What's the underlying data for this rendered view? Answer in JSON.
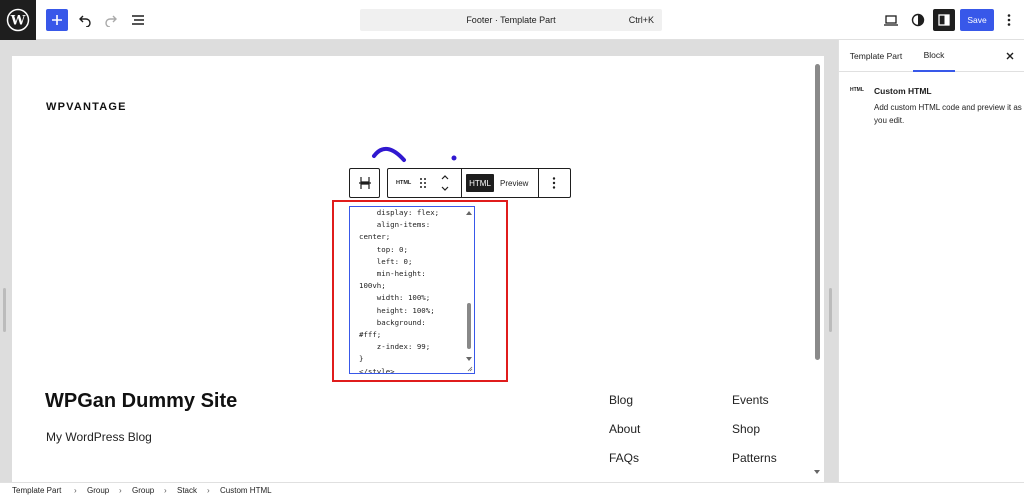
{
  "topbar": {
    "logo_icon": "wordpress-logo-icon",
    "doc_title": "Footer · Template Part",
    "doc_shortcut": "Ctrl+K",
    "save_label": "Save",
    "accent_color": "#3858e9"
  },
  "canvas": {
    "site_logo_text": "WPVANTAGE",
    "site_title": "WPGan Dummy Site",
    "site_tagline": "My WordPress Blog",
    "nav_col1": [
      "Blog",
      "About",
      "FAQs"
    ],
    "nav_col2": [
      "Events",
      "Shop",
      "Patterns"
    ]
  },
  "block_toolbar": {
    "type_label": "HTML",
    "html_tab": "HTML",
    "preview_tab": "Preview"
  },
  "code_editor": {
    "lines": "    display: flex;\n    align-items:\ncenter;\n    top: 0;\n    left: 0;\n    min-height:\n100vh;\n    width: 100%;\n    height: 100%;\n    background:\n#fff;\n    z-index: 99;\n}\n</style>",
    "highlight_color": "#e01c1c"
  },
  "sidebar": {
    "tab_template_part": "Template Part",
    "tab_block": "Block",
    "block_icon_label": "HTML",
    "block_title": "Custom HTML",
    "block_description": "Add custom HTML code and preview it as you edit."
  },
  "breadcrumb": [
    "Template Part",
    "Group",
    "Group",
    "Stack",
    "Custom HTML"
  ]
}
